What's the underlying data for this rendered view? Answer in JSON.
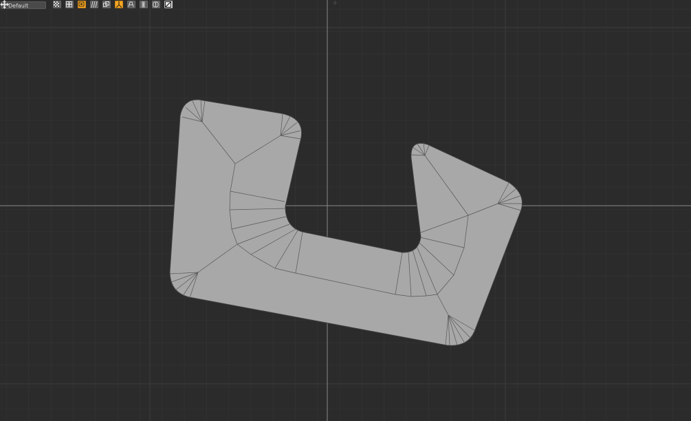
{
  "viewport": {
    "background": "#2b2b2b",
    "grid_color": "#3a3a3a",
    "axis_color": "#7a7a7a",
    "mesh_fill": "#a8a8a8",
    "mesh_edge": "#4a4a4a"
  },
  "toolbar": {
    "preset_label": "Default",
    "accent": "#f5a623",
    "buttons": [
      {
        "icon": "checker-icon",
        "active": false
      },
      {
        "icon": "uv-grid-icon",
        "active": false
      },
      {
        "icon": "face-select-icon",
        "active": true
      },
      {
        "icon": "stripes-icon",
        "active": false
      },
      {
        "icon": "overlap-icon",
        "active": false
      },
      {
        "icon": "pin-icon",
        "active": true
      },
      {
        "icon": "distortion-icon",
        "active": false
      },
      {
        "icon": "stretch-icon",
        "active": false
      },
      {
        "icon": "uv-shell-icon",
        "active": false
      },
      {
        "icon": "wireframe-toggle-icon",
        "active": false
      }
    ]
  },
  "navigation": {
    "icon": "move-view-icon"
  }
}
